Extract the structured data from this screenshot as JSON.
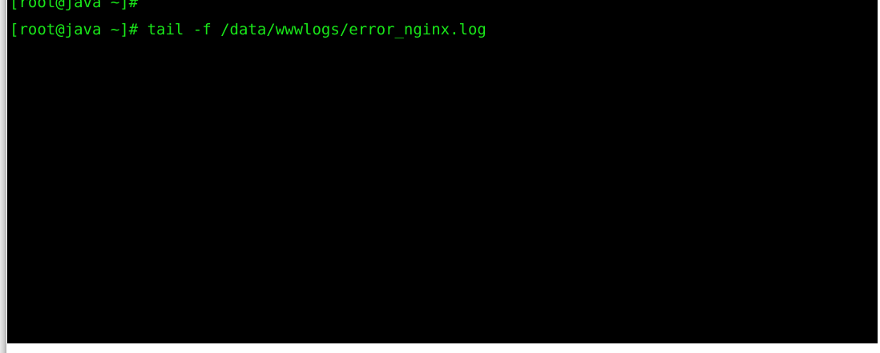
{
  "terminal": {
    "lines": [
      {
        "prompt": "[root@java ~]#",
        "command": ""
      },
      {
        "prompt": "[root@java ~]#",
        "command": " tail -f /data/wwwlogs/error_nginx.log"
      }
    ]
  },
  "colors": {
    "background": "#000000",
    "text": "#19e619"
  }
}
